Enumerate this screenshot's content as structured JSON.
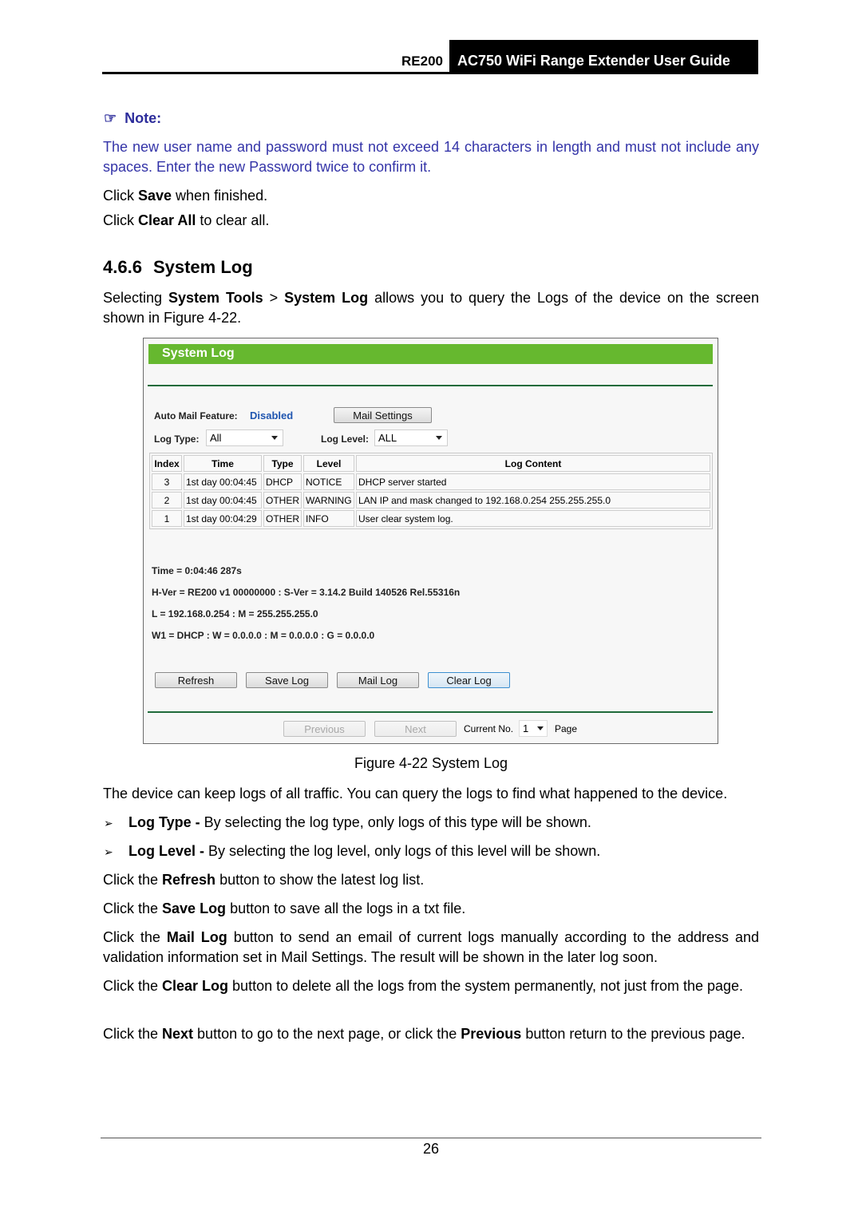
{
  "header": {
    "model": "RE200",
    "title": "AC750 WiFi Range Extender User Guide"
  },
  "note": {
    "icon": "pointing-hand-icon",
    "label": "Note:",
    "text": "The new user name and password must not exceed 14 characters in length and must not include any spaces. Enter the new Password twice to confirm it."
  },
  "intro": {
    "save_pre": "Click ",
    "save_bold": "Save",
    "save_post": " when finished.",
    "clear_pre": "Click ",
    "clear_bold": "Clear All",
    "clear_post": " to clear all."
  },
  "section": {
    "number": "4.6.6",
    "title": "System Log",
    "desc_pre": "Selecting ",
    "desc_b1": "System Tools",
    "desc_mid": " > ",
    "desc_b2": "System Log",
    "desc_post": " allows you to query the Logs of the device on the screen shown in Figure 4-22."
  },
  "figure": {
    "panel_title": "System Log",
    "auto_mail_label": "Auto Mail Feature:",
    "auto_mail_value": "Disabled",
    "mail_settings_button": "Mail Settings",
    "log_type_label": "Log Type:",
    "log_type_value": "All",
    "log_level_label": "Log Level:",
    "log_level_value": "ALL",
    "table": {
      "headers": [
        "Index",
        "Time",
        "Type",
        "Level",
        "Log Content"
      ],
      "rows": [
        [
          "3",
          "1st day 00:04:45",
          "DHCP",
          "NOTICE",
          "DHCP server started"
        ],
        [
          "2",
          "1st day 00:04:45",
          "OTHER",
          "WARNING",
          "LAN IP and mask changed to 192.168.0.254 255.255.255.0"
        ],
        [
          "1",
          "1st day 00:04:29",
          "OTHER",
          "INFO",
          "User clear system log."
        ]
      ]
    },
    "info": {
      "time": "Time = 0:04:46 287s",
      "version": "H-Ver = RE200 v1 00000000 : S-Ver = 3.14.2 Build 140526 Rel.55316n",
      "lan": "L = 192.168.0.254 : M = 255.255.255.0",
      "wan": "W1 = DHCP : W = 0.0.0.0 : M = 0.0.0.0 : G = 0.0.0.0"
    },
    "buttons": {
      "refresh": "Refresh",
      "save_log": "Save Log",
      "mail_log": "Mail Log",
      "clear_log": "Clear Log",
      "previous": "Previous",
      "next": "Next"
    },
    "pager": {
      "current_label": "Current No.",
      "current_value": "1",
      "page_label": "Page"
    },
    "caption": "Figure 4-22 System Log"
  },
  "body": {
    "p1": "The device can keep logs of all traffic. You can query the logs to find what happened to the device.",
    "bullets": [
      {
        "bold": "Log Type -",
        "text": " By selecting the log type, only logs of this type will be shown."
      },
      {
        "bold": "Log Level -",
        "text": " By selecting the log level, only logs of this level will be shown."
      }
    ],
    "refresh": {
      "pre": "Click the ",
      "bold": "Refresh",
      "post": " button to show the latest log list."
    },
    "save": {
      "pre": "Click the ",
      "bold": "Save Log",
      "post": " button to save all the logs in a txt file."
    },
    "mail": {
      "pre": "Click the ",
      "bold": "Mail Log",
      "post": " button to send an email of current logs manually according to the address and validation information set in Mail Settings. The result will be shown in the later log soon."
    },
    "clear": {
      "pre": "Click the ",
      "bold": "Clear Log",
      "post": " button to delete all the logs from the system permanently, not just from the page."
    },
    "nav": {
      "pre": "Click the ",
      "b1": "Next",
      "mid": " button to go to the next page, or click the ",
      "b2": "Previous",
      "post": " button return to the previous page."
    }
  },
  "footer": {
    "page_number": "26"
  }
}
